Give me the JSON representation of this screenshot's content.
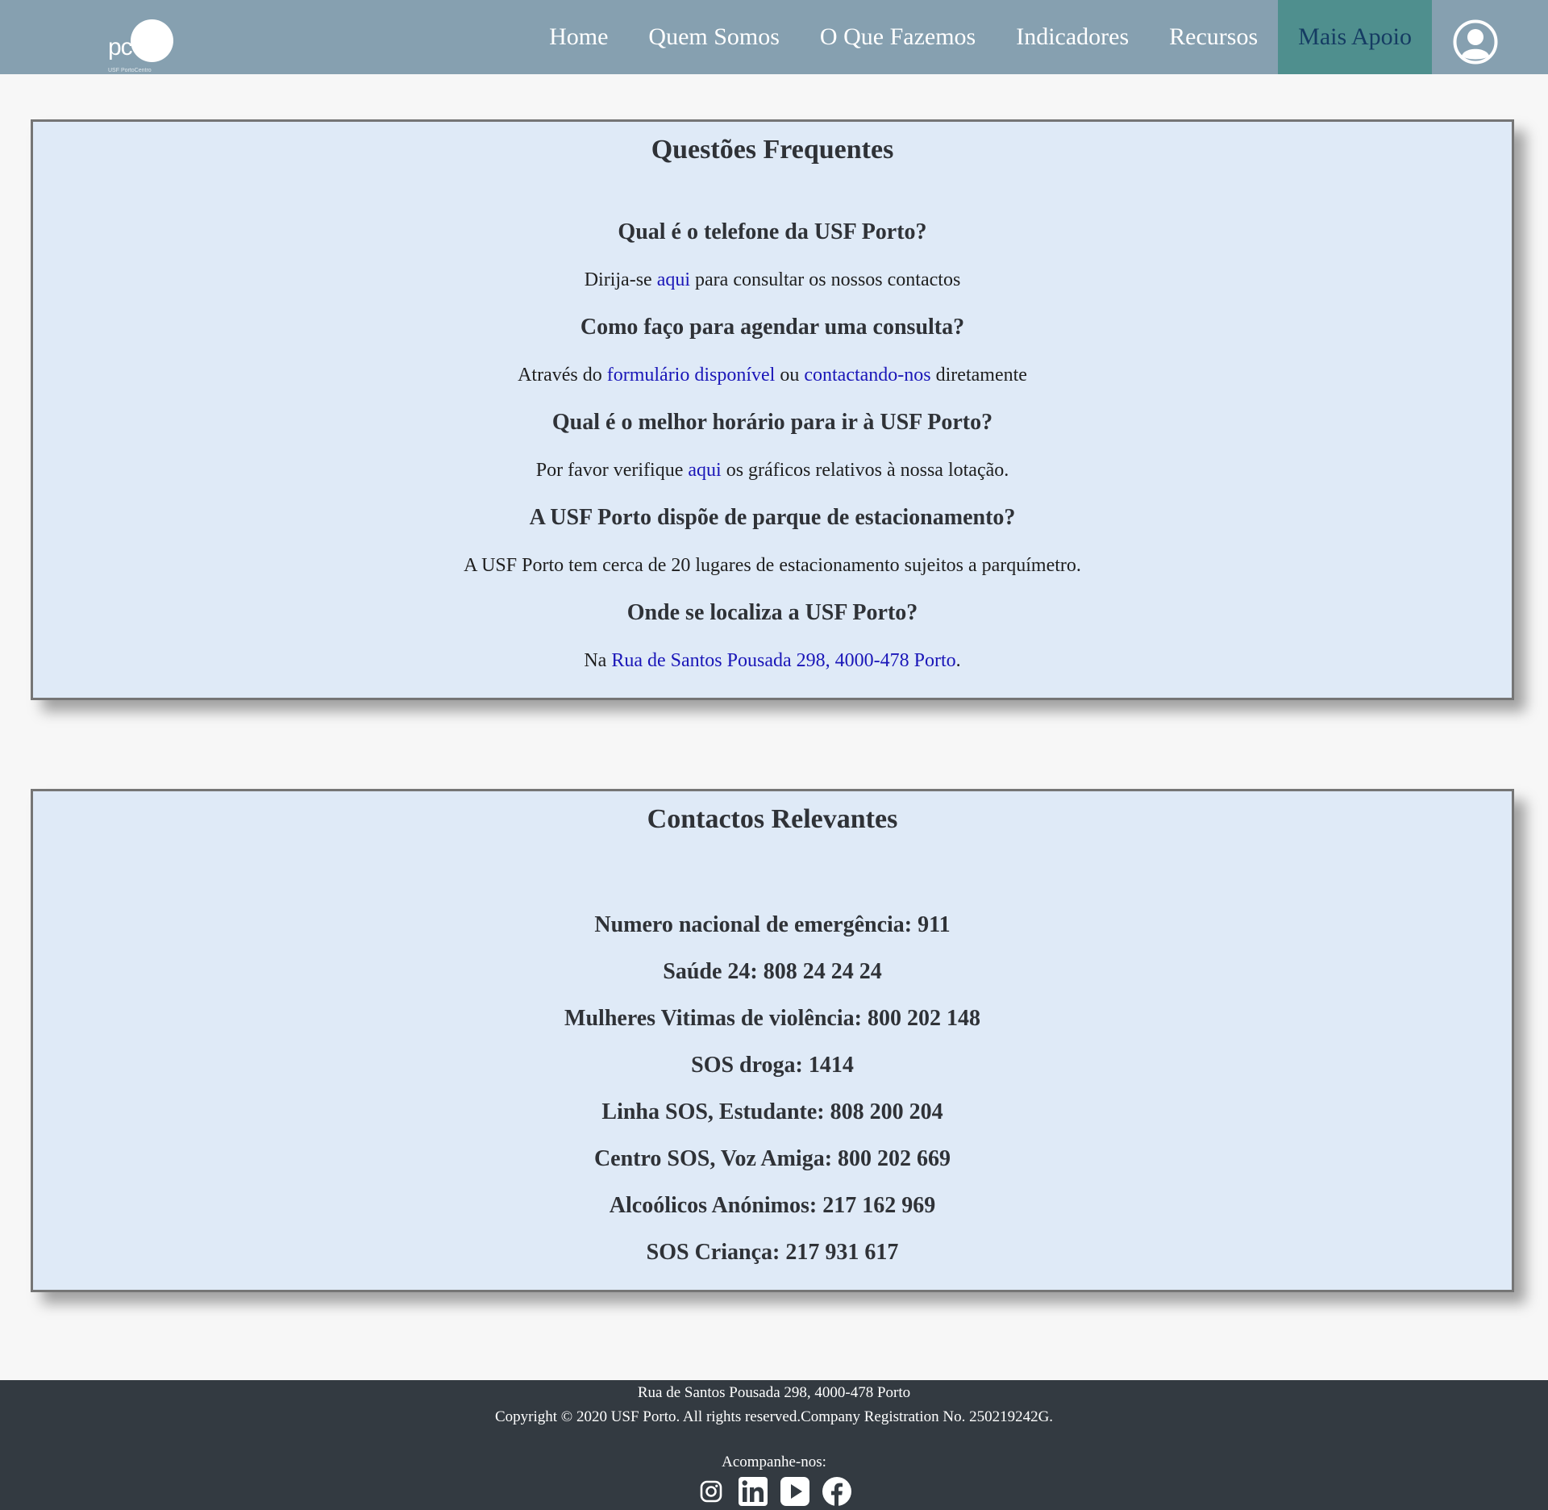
{
  "colors": {
    "navbar": "#86a0b0",
    "active_nav": "#4f8f8e",
    "panel_background": "#dfeaf7",
    "link": "#1a16b8",
    "footer": "#333a41"
  },
  "navbar": {
    "logo": {
      "letters": "pc",
      "caption": "USF PortoCentro",
      "icon": "logo-mark"
    },
    "items": [
      {
        "label": "Home"
      },
      {
        "label": "Quem Somos"
      },
      {
        "label": "O Que Fazemos"
      },
      {
        "label": "Indicadores"
      },
      {
        "label": "Recursos"
      },
      {
        "label": "Mais Apoio",
        "active": true
      }
    ],
    "user_icon": "user-circle-icon"
  },
  "faq": {
    "title": "Questões Frequentes",
    "items": [
      {
        "question": "Qual é o telefone da USF Porto?",
        "answer_pre": "Dirija-se ",
        "answer_link": "aqui",
        "answer_post": " para consultar os nossos contactos"
      },
      {
        "question": "Como faço para agendar uma consulta?",
        "answer_pre": "Através do ",
        "answer_link": "formulário disponível",
        "answer_mid": " ou ",
        "answer_link2": "contactando-nos",
        "answer_post": " diretamente"
      },
      {
        "question": "Qual é o melhor horário para ir à USF Porto?",
        "answer_pre": "Por favor verifique ",
        "answer_link": "aqui",
        "answer_post": " os gráficos relativos à nossa lotação."
      },
      {
        "question": "A USF Porto dispõe de parque de estacionamento?",
        "answer": "A USF Porto tem cerca de 20 lugares de estacionamento sujeitos a parquímetro."
      },
      {
        "question": "Onde se localiza a USF Porto?",
        "answer_pre": "Na ",
        "answer_link": "Rua de Santos Pousada 298, 4000-478 Porto",
        "answer_post": "."
      }
    ]
  },
  "contacts": {
    "title": "Contactos Relevantes",
    "items": [
      "Numero nacional de emergência: 911",
      "Saúde 24: 808 24 24 24",
      "Mulheres Vitimas de violência: 800 202 148",
      "SOS droga: 1414",
      "Linha SOS, Estudante: 808 200 204",
      "Centro SOS, Voz Amiga: 800 202 669",
      "Alcoólicos Anónimos: 217 162 969",
      "SOS Criança: 217 931 617"
    ]
  },
  "footer": {
    "address": "Rua de Santos Pousada 298, 4000-478 Porto",
    "copyright": "Copyright © 2020 USF Porto. All rights reserved.Company Registration No. 250219242G.",
    "follow_label": "Acompanhe-nos:",
    "social_icons": [
      "instagram-icon",
      "linkedin-icon",
      "youtube-icon",
      "facebook-icon"
    ]
  }
}
